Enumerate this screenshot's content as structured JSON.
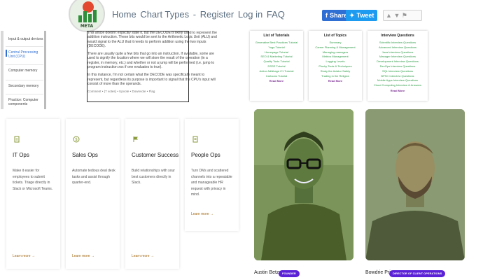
{
  "header": {
    "logo_text": "META",
    "nav_items": [
      "Home",
      "Chart Types",
      "-",
      "Register",
      "Log in",
      "FAQ"
    ],
    "share_facebook": "Share",
    "share_twitter": "Tweet"
  },
  "sidebar": {
    "items": [
      {
        "label": "Input & output devices",
        "active": false
      },
      {
        "label": "Central Processing Unit (CPU)",
        "active": true
      },
      {
        "label": "Computer memory",
        "active": false
      },
      {
        "label": "Secondary memory",
        "active": false
      },
      {
        "label": "Practice: Computer components",
        "active": false
      }
    ]
  },
  "article": {
    "paragraphs": [
      "This article doesn't explicitly state it, but the DECODE is likely used to represent the addition instruction. These bits would be sent to the Arithmetic Logic Unit (ALU) and would signal to the ALU that it needs to perform addition using the two inputs (DECODE).",
      "There are usually quite a few bits that go into an instruction. If available, some are used to signify the location where we will store the result of the operation (in a register, in memory, etc.) and whether or not a jump will be performed (i.e. jump to program instruction xxx if one evaluates to true).",
      "In this instance, I'm not certain what the DECODE was specifically meant to represent, but regardless its purpose is important to signal that the CPU's input will consist of more than the operands."
    ],
    "crossed_note": "Comment  •  (7 votes)  •  Upvote  •  Downvote  •  Flag"
  },
  "tutorial_panels": [
    {
      "title": "List of Tutorials",
      "links": [
        "Generative Best Practices Tutorial",
        "Yoga Tutorial",
        "Homepage Tutorial",
        "SEO & Marketing Tutorial",
        "Quality Tools Tutorial",
        "DSSE Tutorial",
        "Active Adhikage C1 Tutorial",
        "Cartoons Tutorial"
      ],
      "more": "Read More"
    },
    {
      "title": "List of Topics",
      "links": [
        "Summary",
        "Career Planning & Management",
        "Managing managers",
        "Metrics Management",
        "Logging Levels",
        "Plucky Tools & Techniques",
        "Study the Aviator Safely",
        "Trading in the Religion"
      ],
      "more": "Read More"
    },
    {
      "title": "Interview Questions",
      "links": [
        "Scientific Interview Questions",
        "Advanced Interview Questions",
        "Java Interview Questions",
        "Manager Interview Questions",
        "Development Interview Questions",
        "DevOps Interview Questions",
        "SQL Interview Questions",
        "BPSC Interview Questions",
        "Mobile Apps Interview Questions",
        "Cloud Computing Interview & Answers"
      ],
      "more": "Read More"
    }
  ],
  "cards": [
    {
      "title": "IT Ops",
      "description": "Make it easier for employees to submit tickets. Triage directly in Slack or Microsoft Teams.",
      "learn_more": "Learn more →"
    },
    {
      "title": "Sales Ops",
      "description": "Automate tedious deal desk tasks and assist through quarter-end.",
      "learn_more": "Learn more →"
    },
    {
      "title": "Customer Success",
      "description": "Build relationships with your best customers directly in Slack.",
      "learn_more": "Learn more →"
    },
    {
      "title": "People Ops",
      "description": "Turn DMs and scattered channels into a repeatable and manageable HR request with privacy in mind.",
      "learn_more": "Learn more →"
    }
  ],
  "team": [
    {
      "name": "Austin Betzer",
      "role": "FOUNDER"
    },
    {
      "name": "Bowdrie Price",
      "role": "DIRECTOR OF CLIENT OPERATIONS"
    }
  ],
  "colors": {
    "accent_blue": "#2f6fd3",
    "link_green": "#2e9c47",
    "learn_more": "#a36a16",
    "badge_purple": "#5b21d6"
  }
}
